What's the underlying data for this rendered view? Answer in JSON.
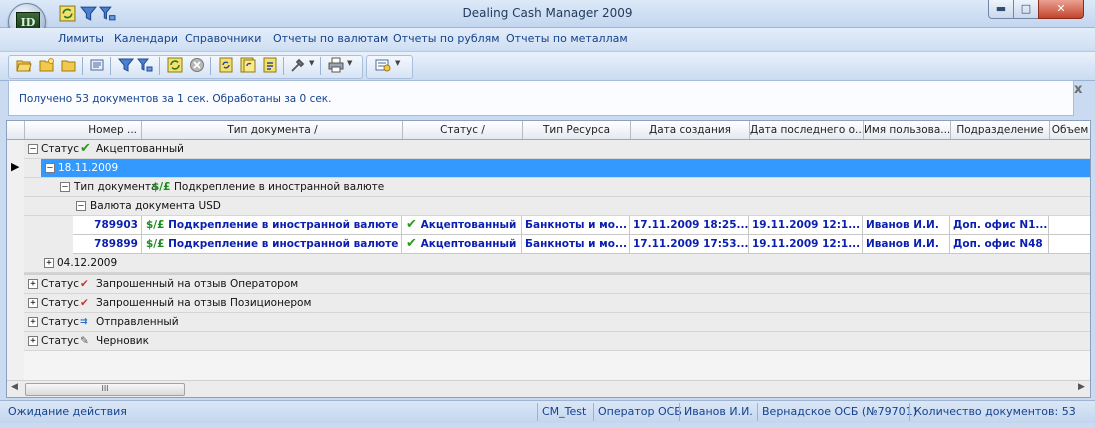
{
  "window": {
    "title": "Dealing Cash Manager 2009",
    "app_logo_text": "ID"
  },
  "titlebar_buttons": {
    "minimize": "▬",
    "maximize": "□",
    "close": "✕"
  },
  "menu": [
    "Лимиты",
    "Календари",
    "Справочники",
    "Отчеты по валютам",
    "Отчеты по рублям",
    "Отчеты по металлам"
  ],
  "info": {
    "message": "Получено 53 документов за 1 сек. Обработаны за 0 сек.",
    "close": "x"
  },
  "grid": {
    "columns": [
      "Номер ...",
      "Тип документа /",
      "Статус /",
      "Тип Ресурса",
      "Дата создания",
      "Дата последнего о...",
      "Имя пользова...",
      "Подразделение",
      "Объем"
    ],
    "groups": {
      "status_accepted": {
        "prefix": "Статус",
        "value": "Акцептованный",
        "expander": "–"
      },
      "date_1": {
        "value": "18.11.2009",
        "expander": "–"
      },
      "doc_type": {
        "prefix": "Тип документа",
        "icon_text": "$/£",
        "value": "Подкрепление в иностранной валюте",
        "expander": "–"
      },
      "currency": {
        "value": "Валюта документа USD",
        "expander": "–"
      },
      "date_2": {
        "value": "04.12.2009",
        "expander": "+"
      },
      "status_operator": {
        "prefix": "Статус",
        "value": "Запрошенный на отзыв Оператором",
        "expander": "+"
      },
      "status_positioner": {
        "prefix": "Статус",
        "value": "Запрошенный на отзыв Позиционером",
        "expander": "+"
      },
      "status_sent": {
        "prefix": "Статус",
        "value": "Отправленный",
        "expander": "+"
      },
      "status_draft": {
        "prefix": "Статус",
        "value": "Черновик",
        "expander": "+"
      }
    },
    "rows": [
      {
        "number": "789903",
        "doc_icon": "$/£",
        "doc_type": "Подкрепление в иностранной валюте",
        "status": "Акцептованный",
        "resource": "Банкноты и мо...",
        "created": "17.11.2009 18:25...",
        "last": "19.11.2009 12:1...",
        "user": "Иванов И.И.",
        "division": "Доп. офис N1..."
      },
      {
        "number": "789899",
        "doc_icon": "$/£",
        "doc_type": "Подкрепление в иностранной валюте",
        "status": "Акцептованный",
        "resource": "Банкноты и мо...",
        "created": "17.11.2009 17:53...",
        "last": "19.11.2009 12:1...",
        "user": "Иванов И.И.",
        "division": "Доп. офис N48"
      }
    ],
    "scroll_thumb": "III"
  },
  "statusbar": {
    "state": "Ожидание действия",
    "db": "CM_Test",
    "role": "Оператор ОСБ",
    "user": "Иванов И.И.",
    "branch": "Вернадское ОСБ (№79701)",
    "count": "Количество документов: 53"
  }
}
